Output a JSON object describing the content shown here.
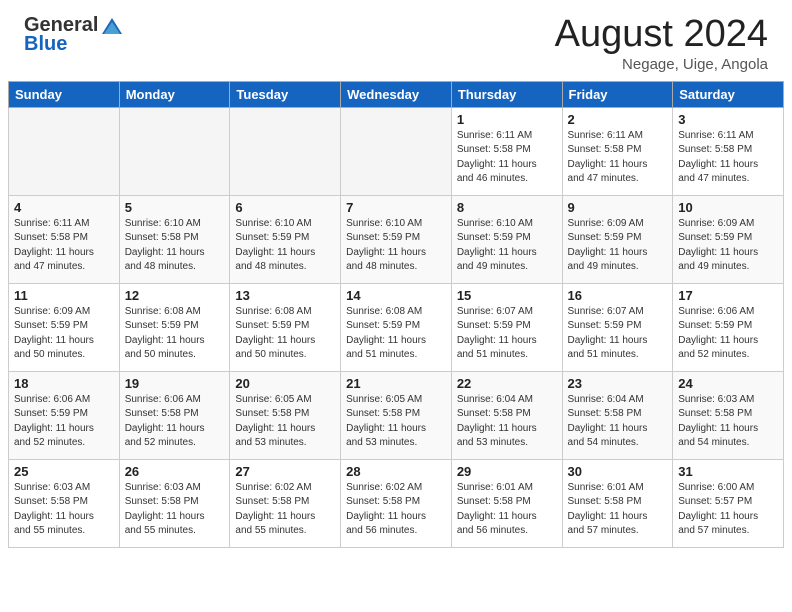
{
  "header": {
    "logo_general": "General",
    "logo_blue": "Blue",
    "title": "August 2024",
    "subtitle": "Negage, Uige, Angola"
  },
  "weekdays": [
    "Sunday",
    "Monday",
    "Tuesday",
    "Wednesday",
    "Thursday",
    "Friday",
    "Saturday"
  ],
  "weeks": [
    [
      {
        "day": "",
        "info": "",
        "empty": true
      },
      {
        "day": "",
        "info": "",
        "empty": true
      },
      {
        "day": "",
        "info": "",
        "empty": true
      },
      {
        "day": "",
        "info": "",
        "empty": true
      },
      {
        "day": "1",
        "info": "Sunrise: 6:11 AM\nSunset: 5:58 PM\nDaylight: 11 hours\nand 46 minutes."
      },
      {
        "day": "2",
        "info": "Sunrise: 6:11 AM\nSunset: 5:58 PM\nDaylight: 11 hours\nand 47 minutes."
      },
      {
        "day": "3",
        "info": "Sunrise: 6:11 AM\nSunset: 5:58 PM\nDaylight: 11 hours\nand 47 minutes."
      }
    ],
    [
      {
        "day": "4",
        "info": "Sunrise: 6:11 AM\nSunset: 5:58 PM\nDaylight: 11 hours\nand 47 minutes."
      },
      {
        "day": "5",
        "info": "Sunrise: 6:10 AM\nSunset: 5:58 PM\nDaylight: 11 hours\nand 48 minutes."
      },
      {
        "day": "6",
        "info": "Sunrise: 6:10 AM\nSunset: 5:59 PM\nDaylight: 11 hours\nand 48 minutes."
      },
      {
        "day": "7",
        "info": "Sunrise: 6:10 AM\nSunset: 5:59 PM\nDaylight: 11 hours\nand 48 minutes."
      },
      {
        "day": "8",
        "info": "Sunrise: 6:10 AM\nSunset: 5:59 PM\nDaylight: 11 hours\nand 49 minutes."
      },
      {
        "day": "9",
        "info": "Sunrise: 6:09 AM\nSunset: 5:59 PM\nDaylight: 11 hours\nand 49 minutes."
      },
      {
        "day": "10",
        "info": "Sunrise: 6:09 AM\nSunset: 5:59 PM\nDaylight: 11 hours\nand 49 minutes."
      }
    ],
    [
      {
        "day": "11",
        "info": "Sunrise: 6:09 AM\nSunset: 5:59 PM\nDaylight: 11 hours\nand 50 minutes."
      },
      {
        "day": "12",
        "info": "Sunrise: 6:08 AM\nSunset: 5:59 PM\nDaylight: 11 hours\nand 50 minutes."
      },
      {
        "day": "13",
        "info": "Sunrise: 6:08 AM\nSunset: 5:59 PM\nDaylight: 11 hours\nand 50 minutes."
      },
      {
        "day": "14",
        "info": "Sunrise: 6:08 AM\nSunset: 5:59 PM\nDaylight: 11 hours\nand 51 minutes."
      },
      {
        "day": "15",
        "info": "Sunrise: 6:07 AM\nSunset: 5:59 PM\nDaylight: 11 hours\nand 51 minutes."
      },
      {
        "day": "16",
        "info": "Sunrise: 6:07 AM\nSunset: 5:59 PM\nDaylight: 11 hours\nand 51 minutes."
      },
      {
        "day": "17",
        "info": "Sunrise: 6:06 AM\nSunset: 5:59 PM\nDaylight: 11 hours\nand 52 minutes."
      }
    ],
    [
      {
        "day": "18",
        "info": "Sunrise: 6:06 AM\nSunset: 5:59 PM\nDaylight: 11 hours\nand 52 minutes."
      },
      {
        "day": "19",
        "info": "Sunrise: 6:06 AM\nSunset: 5:58 PM\nDaylight: 11 hours\nand 52 minutes."
      },
      {
        "day": "20",
        "info": "Sunrise: 6:05 AM\nSunset: 5:58 PM\nDaylight: 11 hours\nand 53 minutes."
      },
      {
        "day": "21",
        "info": "Sunrise: 6:05 AM\nSunset: 5:58 PM\nDaylight: 11 hours\nand 53 minutes."
      },
      {
        "day": "22",
        "info": "Sunrise: 6:04 AM\nSunset: 5:58 PM\nDaylight: 11 hours\nand 53 minutes."
      },
      {
        "day": "23",
        "info": "Sunrise: 6:04 AM\nSunset: 5:58 PM\nDaylight: 11 hours\nand 54 minutes."
      },
      {
        "day": "24",
        "info": "Sunrise: 6:03 AM\nSunset: 5:58 PM\nDaylight: 11 hours\nand 54 minutes."
      }
    ],
    [
      {
        "day": "25",
        "info": "Sunrise: 6:03 AM\nSunset: 5:58 PM\nDaylight: 11 hours\nand 55 minutes."
      },
      {
        "day": "26",
        "info": "Sunrise: 6:03 AM\nSunset: 5:58 PM\nDaylight: 11 hours\nand 55 minutes."
      },
      {
        "day": "27",
        "info": "Sunrise: 6:02 AM\nSunset: 5:58 PM\nDaylight: 11 hours\nand 55 minutes."
      },
      {
        "day": "28",
        "info": "Sunrise: 6:02 AM\nSunset: 5:58 PM\nDaylight: 11 hours\nand 56 minutes."
      },
      {
        "day": "29",
        "info": "Sunrise: 6:01 AM\nSunset: 5:58 PM\nDaylight: 11 hours\nand 56 minutes."
      },
      {
        "day": "30",
        "info": "Sunrise: 6:01 AM\nSunset: 5:58 PM\nDaylight: 11 hours\nand 57 minutes."
      },
      {
        "day": "31",
        "info": "Sunrise: 6:00 AM\nSunset: 5:57 PM\nDaylight: 11 hours\nand 57 minutes."
      }
    ]
  ]
}
